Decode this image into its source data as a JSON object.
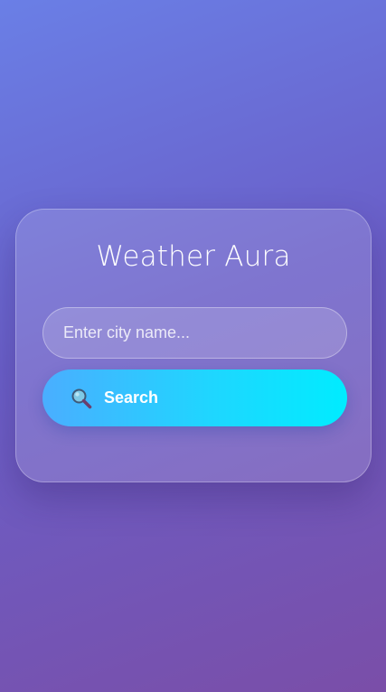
{
  "app": {
    "title": "Weather Aura"
  },
  "search": {
    "placeholder": "Enter city name...",
    "value": "",
    "button_label": "Search",
    "button_icon": "search-icon"
  },
  "colors": {
    "background_start": "#6a7fe6",
    "background_end": "#7a4ea8",
    "button_start": "#4aaeff",
    "button_end": "#00ecff",
    "text": "#ffffff"
  }
}
